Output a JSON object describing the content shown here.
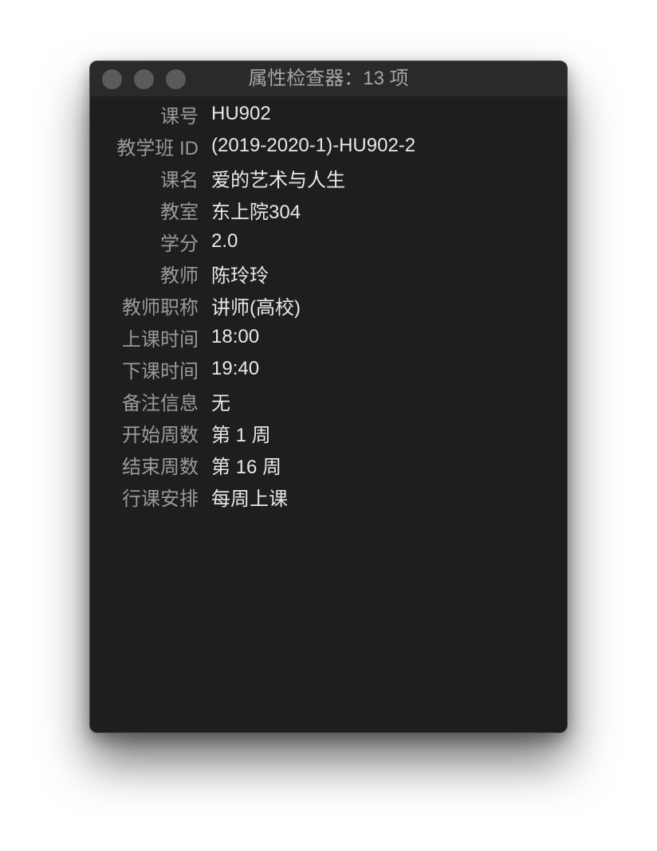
{
  "window": {
    "title": "属性检查器：13 项"
  },
  "properties": [
    {
      "key": "课号",
      "value": "HU902"
    },
    {
      "key": "教学班 ID",
      "value": "(2019-2020-1)-HU902-2"
    },
    {
      "key": "课名",
      "value": "爱的艺术与人生"
    },
    {
      "key": "教室",
      "value": "东上院304"
    },
    {
      "key": "学分",
      "value": "2.0"
    },
    {
      "key": "教师",
      "value": "陈玲玲"
    },
    {
      "key": "教师职称",
      "value": "讲师(高校)"
    },
    {
      "key": "上课时间",
      "value": "18:00"
    },
    {
      "key": "下课时间",
      "value": "19:40"
    },
    {
      "key": "备注信息",
      "value": "无"
    },
    {
      "key": "开始周数",
      "value": "第 1 周"
    },
    {
      "key": "结束周数",
      "value": "第 16 周"
    },
    {
      "key": "行课安排",
      "value": "每周上课"
    }
  ]
}
